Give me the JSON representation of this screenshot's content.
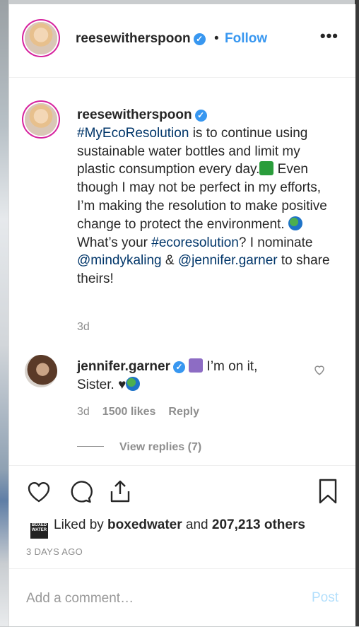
{
  "post": {
    "author": "reesewitherspoon",
    "dot": "•",
    "follow_label": "Follow",
    "more_label": "•••",
    "caption": {
      "author": "reesewitherspoon",
      "hashtag1": "#MyEcoResolution",
      "part1": " is to continue using sustainable water bottles and limit my plastic consumption every day.",
      "part2": " Even though I may not be perfect in my efforts, I’m making the resolution to make positive change to protect the environment. ",
      "part3": " What’s your ",
      "hashtag2": "#ecoresolution",
      "part4": "? I nominate ",
      "mention1": "@mindykaling",
      "amp": " & ",
      "mention2": "@jennifer.garner",
      "part5": " to share theirs!"
    },
    "caption_time": "3d"
  },
  "comment": {
    "author": "jennifer.garner",
    "text1": " I’m on it, Sister. ",
    "heart": "♥",
    "time": "3d",
    "likes": "1500 likes",
    "reply_label": "Reply",
    "view_replies": "View replies (7)"
  },
  "likes": {
    "logo_text": "BOXED WATER",
    "prefix": "Liked by ",
    "user": "boxedwater",
    "mid": " and ",
    "count": "207,213 others"
  },
  "date": "3 DAYS AGO",
  "comment_box": {
    "placeholder": "Add a comment…",
    "post_label": "Post"
  },
  "icons": [
    "heart-icon",
    "comment-icon",
    "share-icon",
    "bookmark-icon",
    "verified-icon",
    "more-icon"
  ],
  "colors": {
    "link": "#003569",
    "follow": "#3897f0",
    "muted": "#8e8e8e"
  }
}
